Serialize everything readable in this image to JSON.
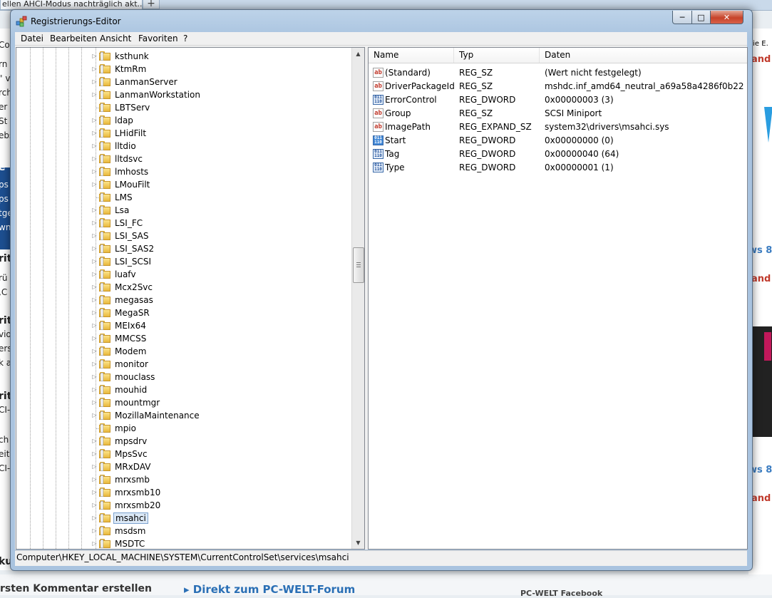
{
  "background": {
    "browser_tab_title": "ellen AHCI-Modus nachträglich akt...",
    "new_tab_symbol": "+",
    "left_fragments": [
      "Co",
      "rn",
      "\" v",
      "rch",
      "er",
      "St",
      "ebs",
      "e",
      "ps",
      "ps",
      "tge",
      "wn",
      "rit",
      "rü",
      ",C",
      "rit",
      "vio",
      "ers",
      "k a",
      "rit",
      "CI-",
      "ch",
      "eits",
      "CI-",
      "ku"
    ],
    "right_fragments": {
      "top_text": "eie E.",
      "red1": "and",
      "blue1": "ws 8",
      "red2": "and",
      "blue2": "ws 8",
      "red3": "and"
    },
    "bottom_left": "rsten Kommentar erstellen",
    "bottom_link": "Direkt zum PC-WELT-Forum",
    "bottom_right": "PC-WELT Facebook"
  },
  "window": {
    "title": "Registrierungs-Editor",
    "controls": {
      "minimize": "─",
      "maximize": "□",
      "close": "✕"
    }
  },
  "menu": [
    "Datei",
    "Bearbeiten",
    "Ansicht",
    "Favoriten",
    "?"
  ],
  "tree": {
    "items": [
      {
        "label": "ksthunk",
        "expandable": true
      },
      {
        "label": "KtmRm",
        "expandable": true
      },
      {
        "label": "LanmanServer",
        "expandable": true
      },
      {
        "label": "LanmanWorkstation",
        "expandable": true
      },
      {
        "label": "LBTServ",
        "expandable": false
      },
      {
        "label": "ldap",
        "expandable": true
      },
      {
        "label": "LHidFilt",
        "expandable": true
      },
      {
        "label": "lltdio",
        "expandable": true
      },
      {
        "label": "lltdsvc",
        "expandable": true
      },
      {
        "label": "lmhosts",
        "expandable": true
      },
      {
        "label": "LMouFilt",
        "expandable": true
      },
      {
        "label": "LMS",
        "expandable": false
      },
      {
        "label": "Lsa",
        "expandable": true
      },
      {
        "label": "LSI_FC",
        "expandable": true
      },
      {
        "label": "LSI_SAS",
        "expandable": true
      },
      {
        "label": "LSI_SAS2",
        "expandable": true
      },
      {
        "label": "LSI_SCSI",
        "expandable": true
      },
      {
        "label": "luafv",
        "expandable": true
      },
      {
        "label": "Mcx2Svc",
        "expandable": true
      },
      {
        "label": "megasas",
        "expandable": true
      },
      {
        "label": "MegaSR",
        "expandable": true
      },
      {
        "label": "MEIx64",
        "expandable": true
      },
      {
        "label": "MMCSS",
        "expandable": true
      },
      {
        "label": "Modem",
        "expandable": true
      },
      {
        "label": "monitor",
        "expandable": true
      },
      {
        "label": "mouclass",
        "expandable": true
      },
      {
        "label": "mouhid",
        "expandable": true
      },
      {
        "label": "mountmgr",
        "expandable": true
      },
      {
        "label": "MozillaMaintenance",
        "expandable": true
      },
      {
        "label": "mpio",
        "expandable": false
      },
      {
        "label": "mpsdrv",
        "expandable": true
      },
      {
        "label": "MpsSvc",
        "expandable": true
      },
      {
        "label": "MRxDAV",
        "expandable": true
      },
      {
        "label": "mrxsmb",
        "expandable": true
      },
      {
        "label": "mrxsmb10",
        "expandable": true
      },
      {
        "label": "mrxsmb20",
        "expandable": true
      },
      {
        "label": "msahci",
        "expandable": true,
        "selected": true
      },
      {
        "label": "msdsm",
        "expandable": true
      },
      {
        "label": "MSDTC",
        "expandable": true
      }
    ]
  },
  "list": {
    "columns": [
      "Name",
      "Typ",
      "Daten"
    ],
    "rows": [
      {
        "name": "(Standard)",
        "type": "REG_SZ",
        "data": "(Wert nicht festgelegt)",
        "icon": "string-value-icon"
      },
      {
        "name": "DriverPackageId",
        "type": "REG_SZ",
        "data": "mshdc.inf_amd64_neutral_a69a58a4286f0b22",
        "icon": "string-value-icon"
      },
      {
        "name": "ErrorControl",
        "type": "REG_DWORD",
        "data": "0x00000003 (3)",
        "icon": "dword-value-icon"
      },
      {
        "name": "Group",
        "type": "REG_SZ",
        "data": "SCSI Miniport",
        "icon": "string-value-icon"
      },
      {
        "name": "ImagePath",
        "type": "REG_EXPAND_SZ",
        "data": "system32\\drivers\\msahci.sys",
        "icon": "string-value-icon"
      },
      {
        "name": "Start",
        "type": "REG_DWORD",
        "data": "0x00000000 (0)",
        "icon": "dword-value-icon",
        "highlighted": true
      },
      {
        "name": "Tag",
        "type": "REG_DWORD",
        "data": "0x00000040 (64)",
        "icon": "dword-value-icon"
      },
      {
        "name": "Type",
        "type": "REG_DWORD",
        "data": "0x00000001 (1)",
        "icon": "dword-value-icon"
      }
    ],
    "icon_text": {
      "string": "ab",
      "dword": "011\n110"
    }
  },
  "statusbar": {
    "path": "Computer\\HKEY_LOCAL_MACHINE\\SYSTEM\\CurrentControlSet\\services\\msahci"
  }
}
